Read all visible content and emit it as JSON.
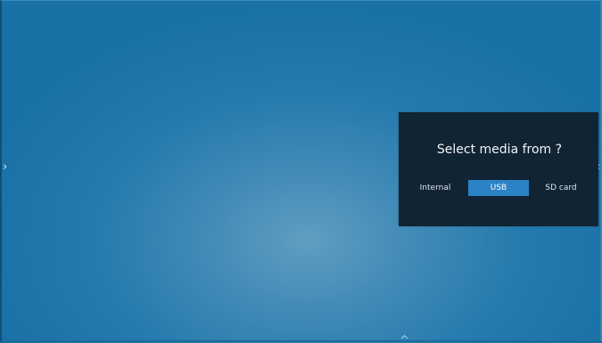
{
  "screen": {
    "nav_left_icon": "chevron-right-icon",
    "nav_right_icon": "chevron-left-icon",
    "nav_left_glyph": "›",
    "nav_right_glyph": "‹"
  },
  "dialog": {
    "title": "Select media from ?",
    "options": [
      {
        "label": "Internal",
        "selected": false
      },
      {
        "label": "USB",
        "selected": true
      },
      {
        "label": "SD card",
        "selected": false
      }
    ]
  },
  "colors": {
    "background": "#1a72a6",
    "dialog_background": "#112433",
    "selected_option": "#2b83c6",
    "text": "#f1f4f7"
  }
}
